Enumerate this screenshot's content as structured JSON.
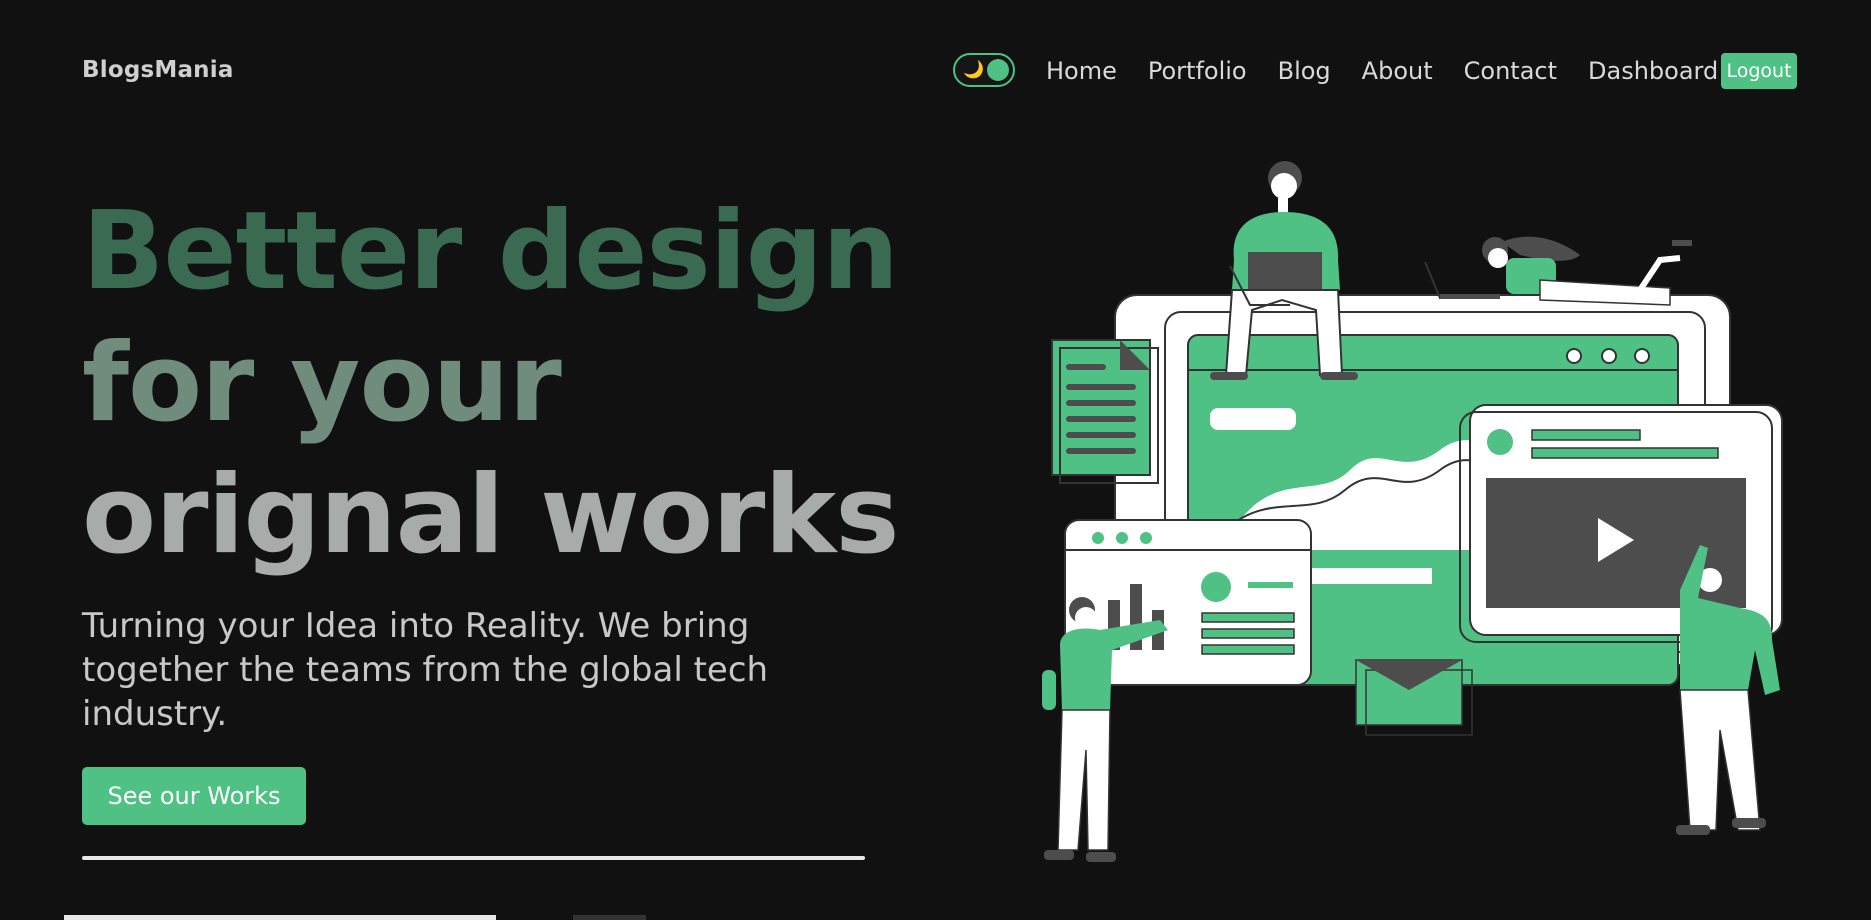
{
  "brand": {
    "name": "BlogsMania"
  },
  "theme_toggle": {
    "icon": "moon-icon",
    "state": "dark"
  },
  "nav": {
    "links": [
      {
        "label": "Home"
      },
      {
        "label": "Portfolio"
      },
      {
        "label": "Blog"
      },
      {
        "label": "About"
      },
      {
        "label": "Contact"
      },
      {
        "label": "Dashboard"
      }
    ],
    "logout_label": "Logout"
  },
  "hero": {
    "title_lines": [
      "Better design",
      "for your",
      "orignal works"
    ],
    "subtitle": "Turning your Idea into Reality. We bring together the teams from the global tech industry.",
    "cta_label": "See our Works"
  },
  "colors": {
    "background": "#111111",
    "accent": "#4fc185",
    "title_line_1": "#3a6b52",
    "title_line_2": "#6f8c7d",
    "title_line_3": "#a7acab"
  },
  "illustration": {
    "icon": "team-web-design-illustration",
    "play_icon": "play-icon",
    "mail_icon": "envelope-icon"
  }
}
